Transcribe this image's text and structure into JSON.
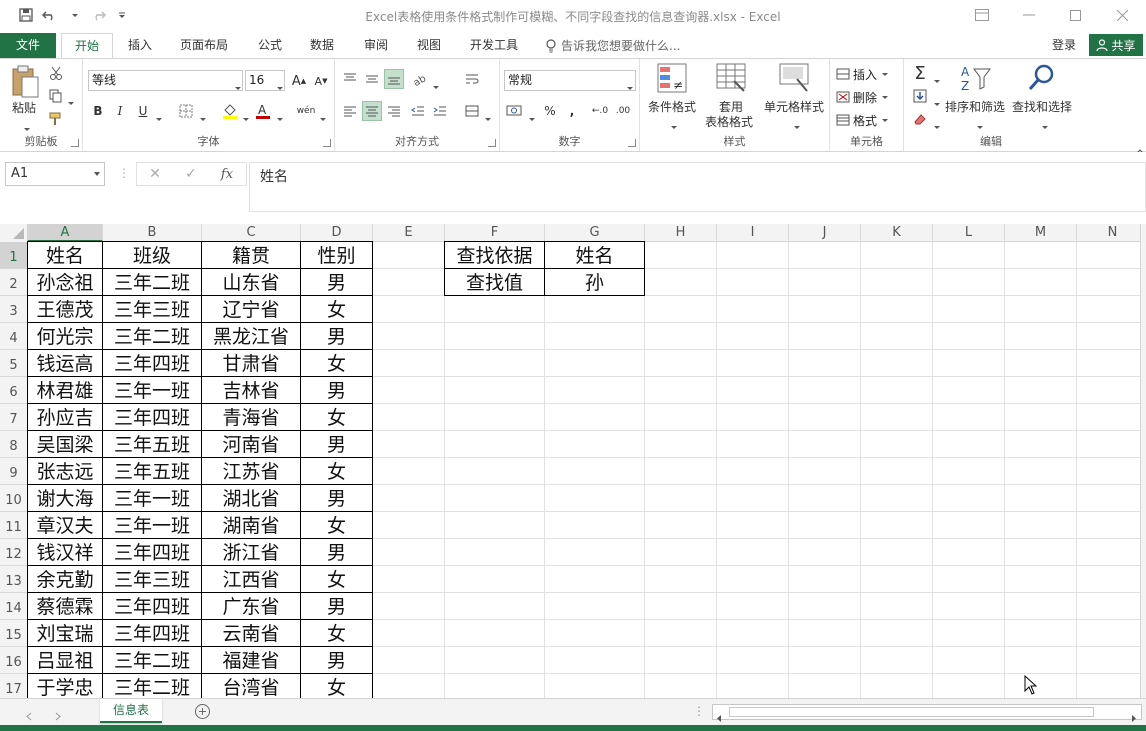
{
  "window": {
    "title": "Excel表格使用条件格式制作可模糊、不同字段查找的信息查询器.xlsx - Excel"
  },
  "tabs": {
    "file": "文件",
    "items": [
      "开始",
      "插入",
      "页面布局",
      "公式",
      "数据",
      "审阅",
      "视图",
      "开发工具"
    ],
    "tell_me": "告诉我您想要做什么...",
    "login": "登录",
    "share": "共享"
  },
  "ribbon": {
    "clipboard": {
      "label": "剪贴板",
      "paste": "粘贴"
    },
    "font": {
      "label": "字体",
      "font_name": "等线",
      "font_size": "16",
      "bold": "B",
      "italic": "I",
      "underline": "U"
    },
    "alignment": {
      "label": "对齐方式"
    },
    "number": {
      "label": "数字",
      "format": "常规",
      "percent": "%",
      "comma": ","
    },
    "styles": {
      "label": "样式",
      "conditional": "条件格式",
      "table_format_1": "套用",
      "table_format_2": "表格格式",
      "cell_styles": "单元格样式"
    },
    "cells": {
      "label": "单元格",
      "insert": "插入",
      "delete": "删除",
      "format": "格式"
    },
    "editing": {
      "label": "编辑",
      "sort_filter": "排序和筛选",
      "find_select": "查找和选择"
    }
  },
  "formula_bar": {
    "name_box": "A1",
    "fx": "fx",
    "content": "姓名"
  },
  "columns": [
    "A",
    "B",
    "C",
    "D",
    "E",
    "F",
    "G",
    "H",
    "I",
    "J",
    "K",
    "L",
    "M",
    "N"
  ],
  "rows": [
    "1",
    "2",
    "3",
    "4",
    "5",
    "6",
    "7",
    "8",
    "9",
    "10",
    "11",
    "12",
    "13",
    "14",
    "15",
    "16",
    "17"
  ],
  "table": {
    "header": [
      "姓名",
      "班级",
      "籍贯",
      "性别"
    ],
    "data": [
      [
        "孙念祖",
        "三年二班",
        "山东省",
        "男"
      ],
      [
        "王德茂",
        "三年三班",
        "辽宁省",
        "女"
      ],
      [
        "何光宗",
        "三年二班",
        "黑龙江省",
        "男"
      ],
      [
        "钱运高",
        "三年四班",
        "甘肃省",
        "女"
      ],
      [
        "林君雄",
        "三年一班",
        "吉林省",
        "男"
      ],
      [
        "孙应吉",
        "三年四班",
        "青海省",
        "女"
      ],
      [
        "吴国梁",
        "三年五班",
        "河南省",
        "男"
      ],
      [
        "张志远",
        "三年五班",
        "江苏省",
        "女"
      ],
      [
        "谢大海",
        "三年一班",
        "湖北省",
        "男"
      ],
      [
        "章汉夫",
        "三年一班",
        "湖南省",
        "女"
      ],
      [
        "钱汉祥",
        "三年四班",
        "浙江省",
        "男"
      ],
      [
        "余克勤",
        "三年三班",
        "江西省",
        "女"
      ],
      [
        "蔡德霖",
        "三年四班",
        "广东省",
        "男"
      ],
      [
        "刘宝瑞",
        "三年四班",
        "云南省",
        "女"
      ],
      [
        "吕显祖",
        "三年二班",
        "福建省",
        "男"
      ],
      [
        "于学忠",
        "三年二班",
        "台湾省",
        "女"
      ]
    ]
  },
  "lookup": {
    "rows": [
      [
        "查找依据",
        "姓名"
      ],
      [
        "查找值",
        "孙"
      ]
    ]
  },
  "sheets": {
    "active": "信息表"
  },
  "colors": {
    "accent": "#217346"
  }
}
